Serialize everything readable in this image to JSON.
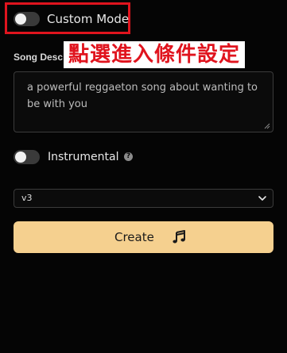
{
  "custom_mode": {
    "label": "Custom Mode",
    "enabled": false
  },
  "annotation": {
    "text": "點選進入條件設定",
    "color": "#e0141e"
  },
  "song_description": {
    "label": "Song Desc",
    "value": "a powerful reggaeton song about wanting to be with you"
  },
  "instrumental": {
    "label": "Instrumental",
    "enabled": false,
    "help_icon": "question-circle-icon"
  },
  "model_select": {
    "value": "v3",
    "icon": "chevron-down-icon"
  },
  "create_button": {
    "label": "Create",
    "icon": "music-note-icon",
    "color": "#f5d08f"
  },
  "theme": {
    "background": "#050505",
    "highlight": "#e0141e"
  }
}
